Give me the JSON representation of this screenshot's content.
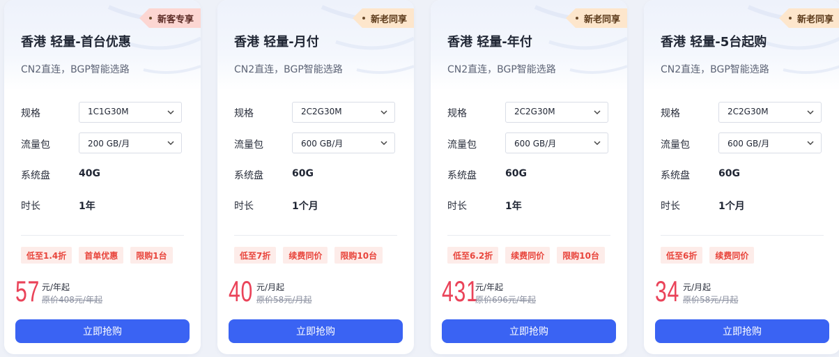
{
  "colors": {
    "accent": "#3a63f3",
    "price": "#ea4359",
    "tag_text": "#e8453c",
    "tag_bg": "#fdece9",
    "ribbon_new_customer_bg": "#fcd6d2",
    "ribbon_both_bg": "#fde6cc"
  },
  "labels": {
    "spec": "规格",
    "traffic": "流量包",
    "disk": "系统盘",
    "duration": "时长",
    "buy": "立即抢购"
  },
  "plans": [
    {
      "ribbon": "新客专享",
      "title": "香港 轻量-首台优惠",
      "subtitle": "CN2直连，BGP智能选路",
      "spec": "1C1G30M",
      "traffic": "200 GB/月",
      "disk": "40G",
      "duration": "1年",
      "tags": [
        "低至1.4折",
        "首单优惠",
        "限购1台"
      ],
      "price": "57",
      "price_unit": "元/年起",
      "original_price": "原价408元/年起"
    },
    {
      "ribbon": "新老同享",
      "title": "香港 轻量-月付",
      "subtitle": "CN2直连，BGP智能选路",
      "spec": "2C2G30M",
      "traffic": "600 GB/月",
      "disk": "60G",
      "duration": "1个月",
      "tags": [
        "低至7折",
        "续费同价",
        "限购10台"
      ],
      "price": "40",
      "price_unit": "元/月起",
      "original_price": "原价58元/月起"
    },
    {
      "ribbon": "新老同享",
      "title": "香港 轻量-年付",
      "subtitle": "CN2直连，BGP智能选路",
      "spec": "2C2G30M",
      "traffic": "600 GB/月",
      "disk": "60G",
      "duration": "1年",
      "tags": [
        "低至6.2折",
        "续费同价",
        "限购10台"
      ],
      "price": "431",
      "price_unit": "元/年起",
      "original_price": "原价696元/年起"
    },
    {
      "ribbon": "新老同享",
      "title": "香港 轻量-5台起购",
      "subtitle": "CN2直连，BGP智能选路",
      "spec": "2C2G30M",
      "traffic": "600 GB/月",
      "disk": "60G",
      "duration": "1个月",
      "tags": [
        "低至6折",
        "续费同价"
      ],
      "price": "34",
      "price_unit": "元/月起",
      "original_price": "原价58元/月起"
    }
  ]
}
